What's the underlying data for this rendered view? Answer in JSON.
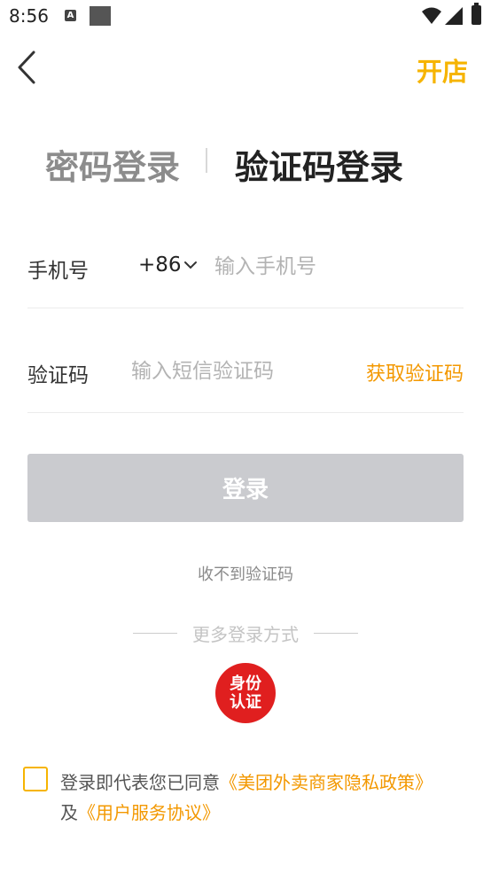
{
  "status_bar": {
    "time": "8:56",
    "a_icon_text": "A"
  },
  "header": {
    "open_store": "开店"
  },
  "tabs": [
    {
      "label": "密码登录",
      "active": false
    },
    {
      "label": "验证码登录",
      "active": true
    }
  ],
  "form": {
    "phone_label": "手机号",
    "country_code": "+86",
    "phone_placeholder": "输入手机号",
    "code_label": "验证码",
    "code_placeholder": "输入短信验证码",
    "get_code": "获取验证码"
  },
  "login_button": "登录",
  "no_code": "收不到验证码",
  "more_methods": "更多登录方式",
  "id_auth": "身份认证",
  "agreement": {
    "checked": false,
    "prefix": "登录即代表您已同意",
    "privacy_policy": "《美团外卖商家隐私政策》",
    "and": "及",
    "user_agreement": "《用户服务协议》"
  },
  "colors": {
    "accent": "#f6b400",
    "link": "#f39800",
    "button_disabled": "#cacbcf",
    "id_badge": "#e01f1f"
  }
}
